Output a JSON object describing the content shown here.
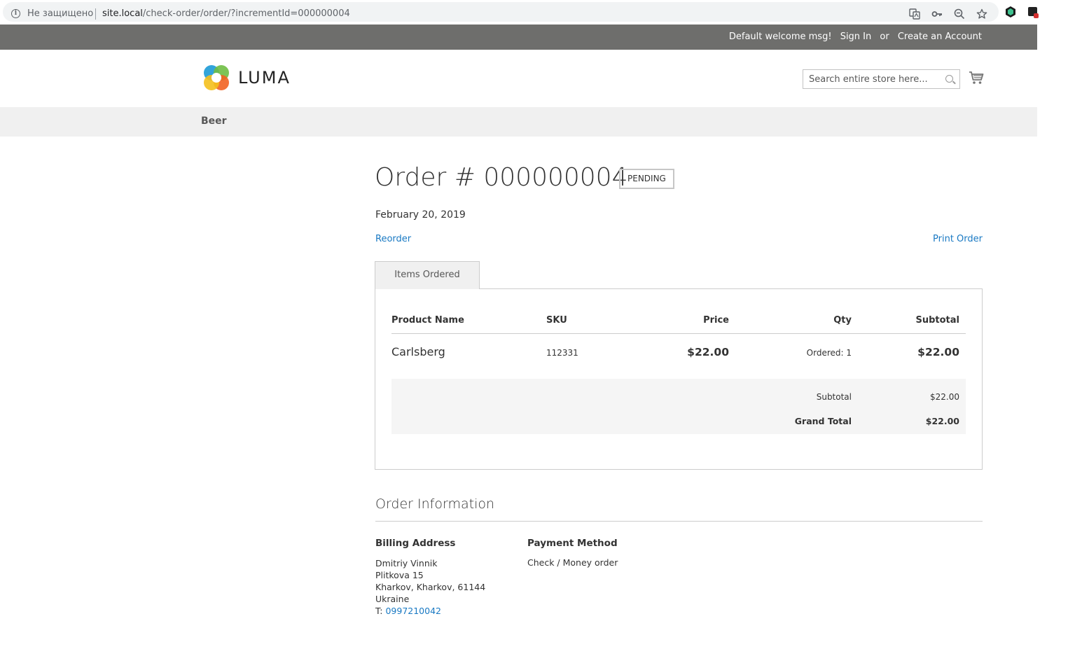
{
  "browser": {
    "security_label": "Не защищено",
    "url_host": "site.local",
    "url_path": "/check-order/order/?incrementId=000000004"
  },
  "panel": {
    "welcome": "Default welcome msg!",
    "sign_in": "Sign In",
    "or": "or",
    "create_account": "Create an Account"
  },
  "header": {
    "logo_text": "LUMA",
    "search_placeholder": "Search entire store here..."
  },
  "nav": {
    "items": [
      {
        "label": "Beer"
      }
    ]
  },
  "order": {
    "title": "Order # 000000004",
    "status": "PENDING",
    "date": "February 20, 2019",
    "reorder_label": "Reorder",
    "print_label": "Print Order",
    "tab_label": "Items Ordered",
    "columns": [
      "Product Name",
      "SKU",
      "Price",
      "Qty",
      "Subtotal"
    ],
    "items": [
      {
        "name": "Carlsberg",
        "sku": "112331",
        "price": "$22.00",
        "qty": "Ordered: 1",
        "subtotal": "$22.00"
      }
    ],
    "totals": {
      "subtotal_label": "Subtotal",
      "subtotal_value": "$22.00",
      "grand_total_label": "Grand Total",
      "grand_total_value": "$22.00"
    }
  },
  "info": {
    "title": "Order Information",
    "billing_title": "Billing Address",
    "billing": {
      "name": "Dmitriy Vinnik",
      "street": "Plitkova 15",
      "city_line": "Kharkov, Kharkov, 61144",
      "country": "Ukraine",
      "phone_prefix": "T:",
      "phone": "0997210042"
    },
    "payment_title": "Payment Method",
    "payment": "Check / Money order"
  }
}
